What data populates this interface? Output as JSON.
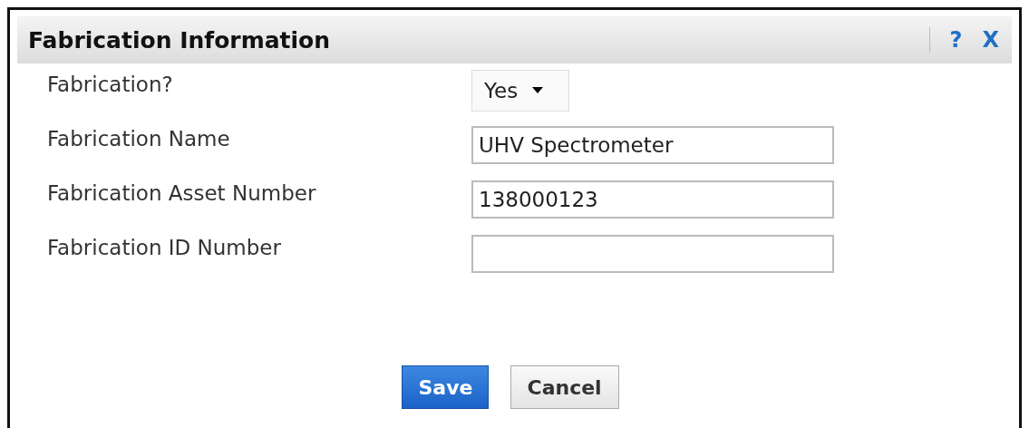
{
  "dialog": {
    "title": "Fabrication Information",
    "header_buttons": [
      "?",
      "X"
    ]
  },
  "fields": [
    {
      "kind": "select",
      "label": "Fabrication?",
      "value": "Yes"
    },
    {
      "kind": "text",
      "label": "Fabrication Name",
      "value": "UHV Spectrometer"
    },
    {
      "kind": "text",
      "label": "Fabrication Asset Number",
      "value": "138000123"
    },
    {
      "kind": "text",
      "label": "Fabrication ID Number"
    }
  ],
  "buttons": [
    {
      "kind": "primary",
      "label": "Save"
    },
    {
      "kind": "secondary",
      "label": "Cancel"
    }
  ]
}
